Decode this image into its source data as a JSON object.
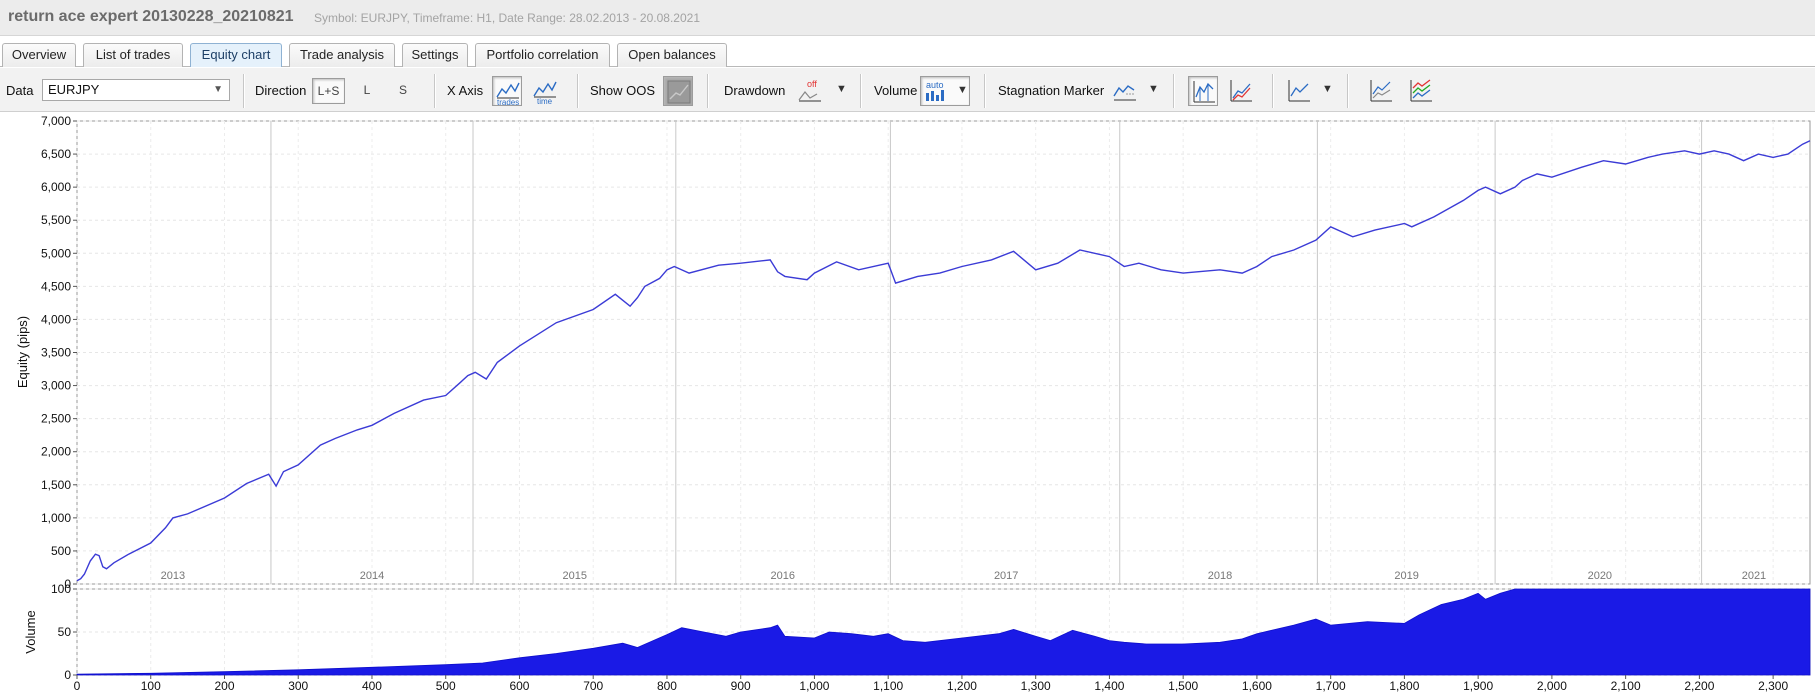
{
  "window": {
    "title": "return ace expert 20130228_20210821",
    "subtitle": "Symbol: EURJPY, Timeframe: H1, Date Range: 28.02.2013 - 20.08.2021"
  },
  "tabs": [
    {
      "label": "Overview",
      "active": false
    },
    {
      "label": "List of trades",
      "active": false
    },
    {
      "label": "Equity chart",
      "active": true
    },
    {
      "label": "Trade analysis",
      "active": false
    },
    {
      "label": "Settings",
      "active": false
    },
    {
      "label": "Portfolio correlation",
      "active": false
    },
    {
      "label": "Open balances",
      "active": false
    }
  ],
  "toolbar": {
    "data_label": "Data",
    "data_value": "EURJPY",
    "direction_label": "Direction",
    "direction_options": [
      "L+S",
      "L",
      "S"
    ],
    "direction_selected": "L+S",
    "xaxis_label": "X Axis",
    "xaxis_trades_icon_text": "trades",
    "xaxis_time_icon_text": "time",
    "show_oos_label": "Show OOS",
    "drawdown_label": "Drawdown",
    "drawdown_icon_text": "off",
    "volume_label": "Volume",
    "volume_icon_text": "auto",
    "stagnation_label": "Stagnation Marker"
  },
  "icons": [
    "chevron-down-icon",
    "trades-axis-icon",
    "time-axis-icon",
    "oos-icon",
    "drawdown-icon",
    "volume-icon",
    "stagnation-icon",
    "chart-type-bar-icon",
    "chart-type-line-icon",
    "line-style-icon",
    "chart-compare-icon",
    "multi-series-icon"
  ],
  "colors": {
    "equity_line": "#3b3bd6",
    "volume_fill": "#1a1ae6",
    "active_tab_bg": "#e5f1fb",
    "oos_red": "#e33333"
  },
  "chart_data": [
    {
      "type": "line",
      "ylabel": "Equity (pips)",
      "ylim": [
        0,
        7000
      ],
      "yticks": [
        "0",
        "500",
        "1,000",
        "1,500",
        "2,000",
        "2,500",
        "3,000",
        "3,500",
        "4,000",
        "4,500",
        "5,000",
        "5,500",
        "6,000",
        "6,500",
        "7,000"
      ],
      "xlim": [
        0,
        2350
      ],
      "year_labels": [
        {
          "label": "2013",
          "x": 130
        },
        {
          "label": "2014",
          "x": 400
        },
        {
          "label": "2015",
          "x": 675
        },
        {
          "label": "2016",
          "x": 957
        },
        {
          "label": "2017",
          "x": 1260
        },
        {
          "label": "2018",
          "x": 1550
        },
        {
          "label": "2019",
          "x": 1803
        },
        {
          "label": "2020",
          "x": 2065
        },
        {
          "label": "2021",
          "x": 2274
        }
      ],
      "year_boundaries": [
        263,
        537,
        812,
        1103,
        1414,
        1682,
        1923,
        2203
      ],
      "series": [
        {
          "x": [
            0,
            5,
            10,
            18,
            25,
            30,
            35,
            40,
            50,
            70,
            100,
            120,
            130,
            150,
            200,
            230,
            260,
            270,
            280,
            300,
            330,
            350,
            380,
            400,
            430,
            470,
            500,
            520,
            530,
            540,
            555,
            570,
            600,
            650,
            700,
            730,
            750,
            760,
            770,
            790,
            800,
            810,
            830,
            870,
            900,
            940,
            950,
            960,
            990,
            1000,
            1030,
            1060,
            1100,
            1110,
            1140,
            1170,
            1200,
            1240,
            1270,
            1300,
            1330,
            1360,
            1400,
            1420,
            1440,
            1470,
            1500,
            1550,
            1580,
            1600,
            1620,
            1650,
            1680,
            1700,
            1730,
            1760,
            1800,
            1810,
            1840,
            1880,
            1900,
            1910,
            1930,
            1950,
            1960,
            1980,
            2000,
            2040,
            2070,
            2100,
            2130,
            2150,
            2180,
            2200,
            2220,
            2240,
            2260,
            2280,
            2300,
            2320,
            2340,
            2350
          ],
          "y": [
            50,
            80,
            150,
            350,
            450,
            430,
            260,
            230,
            320,
            450,
            620,
            850,
            1000,
            1060,
            1300,
            1520,
            1660,
            1480,
            1700,
            1800,
            2100,
            2200,
            2330,
            2400,
            2580,
            2780,
            2850,
            3050,
            3150,
            3200,
            3100,
            3350,
            3600,
            3950,
            4150,
            4380,
            4200,
            4330,
            4500,
            4620,
            4750,
            4800,
            4700,
            4820,
            4850,
            4900,
            4720,
            4650,
            4600,
            4700,
            4870,
            4750,
            4850,
            4550,
            4650,
            4700,
            4800,
            4900,
            5030,
            4750,
            4850,
            5050,
            4950,
            4800,
            4850,
            4750,
            4700,
            4750,
            4700,
            4800,
            4950,
            5050,
            5200,
            5400,
            5250,
            5350,
            5450,
            5400,
            5550,
            5800,
            5950,
            6000,
            5900,
            6000,
            6100,
            6200,
            6150,
            6300,
            6400,
            6350,
            6450,
            6500,
            6550,
            6500,
            6550,
            6500,
            6400,
            6500,
            6450,
            6500,
            6650,
            6700
          ]
        }
      ]
    },
    {
      "type": "area",
      "ylabel": "Volume",
      "ylim": [
        0,
        100
      ],
      "yticks": [
        "0",
        "50",
        "100"
      ],
      "xlim": [
        0,
        2350
      ],
      "xticks": [
        "0",
        "100",
        "200",
        "300",
        "400",
        "500",
        "600",
        "700",
        "800",
        "900",
        "1,000",
        "1,100",
        "1,200",
        "1,300",
        "1,400",
        "1,500",
        "1,600",
        "1,700",
        "1,800",
        "1,900",
        "2,000",
        "2,100",
        "2,200",
        "2,300"
      ],
      "series": [
        {
          "x": [
            0,
            100,
            200,
            300,
            400,
            500,
            550,
            600,
            650,
            700,
            740,
            760,
            800,
            820,
            850,
            880,
            900,
            940,
            950,
            960,
            1000,
            1020,
            1050,
            1080,
            1100,
            1120,
            1150,
            1200,
            1250,
            1270,
            1300,
            1320,
            1350,
            1380,
            1400,
            1420,
            1450,
            1500,
            1550,
            1580,
            1600,
            1650,
            1680,
            1700,
            1750,
            1800,
            1820,
            1850,
            1880,
            1900,
            1910,
            1930,
            1950,
            2350
          ],
          "y": [
            1,
            2,
            4,
            6,
            9,
            12,
            14,
            20,
            25,
            31,
            37,
            32,
            47,
            55,
            50,
            45,
            50,
            55,
            58,
            45,
            43,
            50,
            48,
            45,
            48,
            40,
            38,
            43,
            48,
            53,
            45,
            40,
            52,
            45,
            40,
            38,
            36,
            36,
            38,
            42,
            48,
            58,
            65,
            58,
            62,
            60,
            70,
            82,
            88,
            95,
            88,
            95,
            100,
            100
          ]
        }
      ]
    }
  ]
}
